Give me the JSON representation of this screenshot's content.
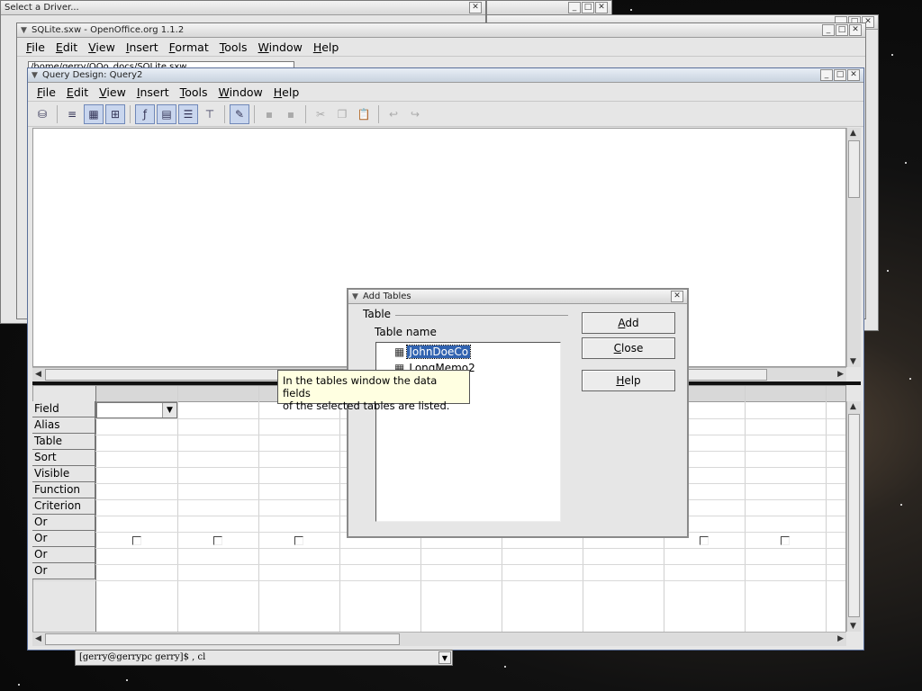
{
  "select_driver_window": {
    "title": "Select a Driver..."
  },
  "sqlite_window": {
    "title": "SQLite.sxw - OpenOffice.org 1.1.2",
    "menu": [
      "File",
      "Edit",
      "View",
      "Insert",
      "Format",
      "Tools",
      "Window",
      "Help"
    ],
    "path_value": "/home/gerry/OOo_docs/SQLite.sxw"
  },
  "query_window": {
    "title": "Query Design: Query2",
    "menu": [
      "File",
      "Edit",
      "View",
      "Insert",
      "Tools",
      "Window",
      "Help"
    ],
    "grid_rows": [
      "Field",
      "Alias",
      "Table",
      "Sort",
      "Visible",
      "Function",
      "Criterion",
      "Or",
      "Or",
      "Or",
      "Or"
    ]
  },
  "add_tables_dialog": {
    "title": "Add Tables",
    "group_label": "Table",
    "list_header": "Table name",
    "tables": [
      "JohnDoeCo",
      "LongMemo2"
    ],
    "selected_index": 0,
    "buttons": {
      "add": "Add",
      "close": "Close",
      "help": "Help"
    }
  },
  "tooltip": {
    "line1": "In the tables window the data fields",
    "line2": "of the selected tables are listed."
  },
  "terminal": {
    "prompt": "[gerry@gerrypc gerry]$ , cl"
  },
  "icons": {
    "titlebar_menu": "window-menu-icon",
    "minimize": "minimize-icon",
    "maximize": "maximize-icon",
    "close": "close-icon",
    "table": "table-icon"
  },
  "colors": {
    "selection": "#3163b0",
    "tooltip_bg": "#ffffe1",
    "window_bg": "#e6e6e6"
  }
}
